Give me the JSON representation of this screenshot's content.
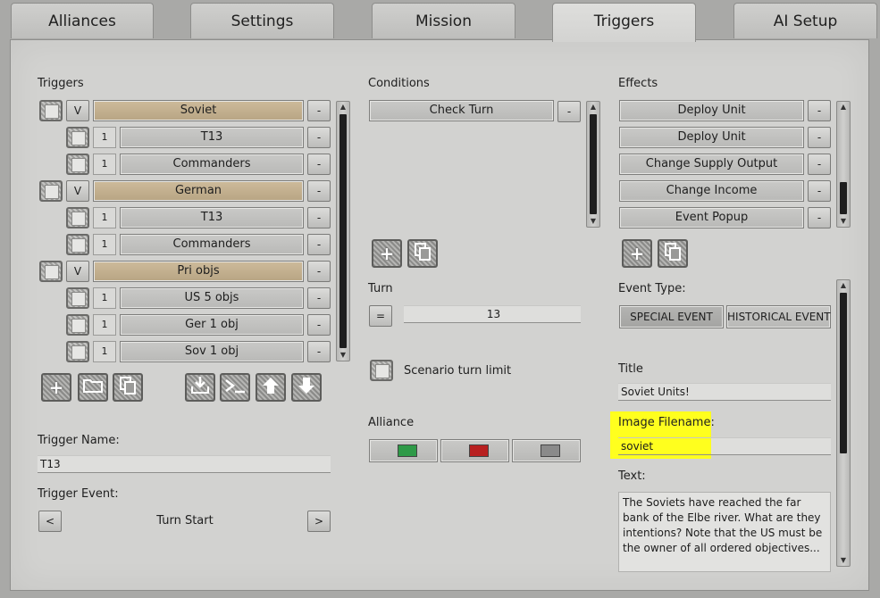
{
  "tabs": [
    {
      "label": "Alliances"
    },
    {
      "label": "Settings"
    },
    {
      "label": "Mission"
    },
    {
      "label": "Triggers"
    },
    {
      "label": "AI Setup"
    }
  ],
  "triggers": {
    "heading": "Triggers",
    "rows": [
      {
        "type": "group",
        "toggle": "V",
        "label": "Soviet",
        "remove": "-"
      },
      {
        "type": "child",
        "count": "1",
        "label": "T13",
        "remove": "-"
      },
      {
        "type": "child",
        "count": "1",
        "label": "Commanders",
        "remove": "-"
      },
      {
        "type": "group",
        "toggle": "V",
        "label": "German",
        "remove": "-"
      },
      {
        "type": "child",
        "count": "1",
        "label": "T13",
        "remove": "-"
      },
      {
        "type": "child",
        "count": "1",
        "label": "Commanders",
        "remove": "-"
      },
      {
        "type": "group",
        "toggle": "V",
        "label": "Pri objs",
        "remove": "-"
      },
      {
        "type": "child",
        "count": "1",
        "label": "US 5 objs",
        "remove": "-"
      },
      {
        "type": "child",
        "count": "1",
        "label": "Ger 1 obj",
        "remove": "-"
      },
      {
        "type": "child",
        "count": "1",
        "label": "Sov 1 obj",
        "remove": "-"
      }
    ],
    "toolbar_icons": [
      "plus-icon",
      "folder-icon",
      "copy-icon",
      "import-icon",
      "console-icon",
      "arrow-up-icon",
      "arrow-down-icon"
    ]
  },
  "trigger_name": {
    "label": "Trigger Name:",
    "value": "T13"
  },
  "trigger_event": {
    "label": "Trigger Event:",
    "prev": "<",
    "value": "Turn Start",
    "next": ">"
  },
  "conditions": {
    "heading": "Conditions",
    "items": [
      {
        "label": "Check Turn",
        "remove": "-"
      }
    ]
  },
  "turn": {
    "label": "Turn",
    "operator": "=",
    "value": "13"
  },
  "scenario_turn_limit": {
    "label": "Scenario turn limit"
  },
  "alliance": {
    "label": "Alliance",
    "options": [
      {
        "color": "#2f9a48"
      },
      {
        "color": "#b82020"
      },
      {
        "color": "#8a8a8a"
      }
    ]
  },
  "effects": {
    "heading": "Effects",
    "items": [
      {
        "label": "Deploy Unit",
        "remove": "-"
      },
      {
        "label": "Deploy Unit",
        "remove": "-"
      },
      {
        "label": "Change Supply Output",
        "remove": "-"
      },
      {
        "label": "Change Income",
        "remove": "-"
      },
      {
        "label": "Event Popup",
        "remove": "-"
      }
    ]
  },
  "event": {
    "type_label": "Event Type:",
    "types": [
      {
        "label": "SPECIAL EVENT"
      },
      {
        "label": "HISTORICAL EVENT"
      }
    ],
    "title_label": "Title",
    "title_value": "Soviet Units!",
    "image_label": "Image Filename:",
    "image_value": "soviet",
    "text_label": "Text:",
    "text_value": "The Soviets have reached the far bank of the Elbe river. What are they intentions? Note that the US must be the owner of all ordered objectives..."
  },
  "colors": {
    "highlight": "#ffff1e",
    "group_row": "#c4b08e"
  }
}
